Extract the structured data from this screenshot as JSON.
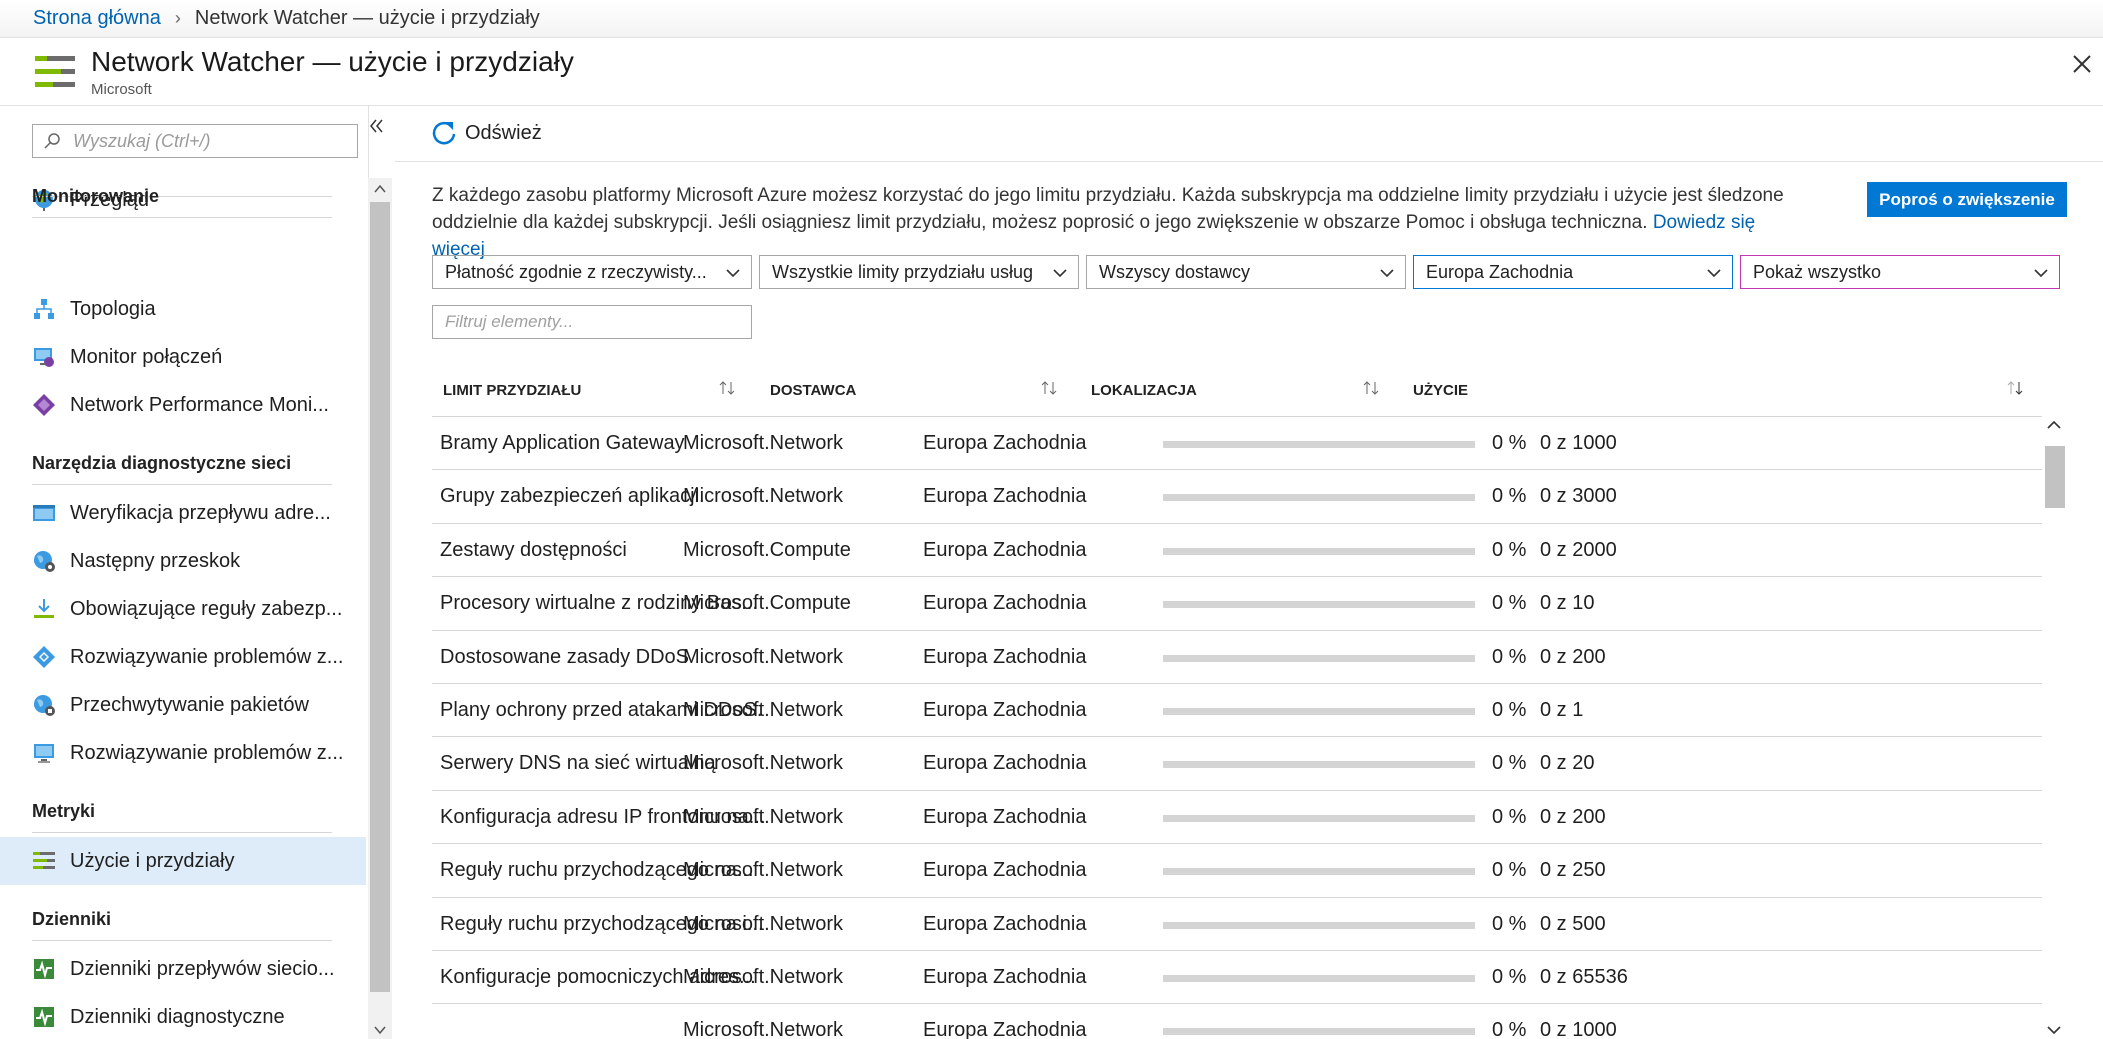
{
  "breadcrumb": {
    "home": "Strona główna",
    "current": "Network Watcher — użycie i przydziały"
  },
  "header": {
    "title": "Network Watcher — użycie i przydziały",
    "subtitle": "Microsoft"
  },
  "sidebar": {
    "search_placeholder": "Wyszukaj (Ctrl+/)",
    "overview": "Przegląd",
    "sections": {
      "monitoring": "Monitorowanie",
      "diagnostics": "Narzędzia diagnostyczne sieci",
      "metrics": "Metryki",
      "logs": "Dzienniki"
    },
    "items": {
      "topology": "Topologia",
      "connection_monitor": "Monitor połączeń",
      "npm": "Network Performance Moni...",
      "ip_flow": "Weryfikacja przepływu adre...",
      "next_hop": "Następny przeskok",
      "security_rules": "Obowiązujące reguły zabezp...",
      "vpn_troubleshoot": "Rozwiązywanie problemów z...",
      "packet_capture": "Przechwytywanie pakietów",
      "connection_troubleshoot": "Rozwiązywanie problemów z...",
      "usage_quotas": "Użycie i przydziały",
      "nsg_flow_logs": "Dzienniki przepływów siecio...",
      "diagnostic_logs": "Dzienniki diagnostyczne"
    }
  },
  "toolbar": {
    "refresh": "Odśwież"
  },
  "description": {
    "text": "Z każdego zasobu platformy Microsoft Azure możesz korzystać do jego limitu przydziału. Każda subskrypcja ma oddzielne limity przydziału i użycie jest śledzone oddzielnie dla każdej subskrypcji. Jeśli osiągniesz limit przydziału, możesz poprosić o jego zwiększenie w obszarze Pomoc i obsługa techniczna.",
    "learn_more": "Dowiedz się więcej"
  },
  "request_increase": "Poproś o zwiększenie",
  "filters": {
    "billing": "Płatność zgodnie z rzeczywisty...",
    "quota_limits": "Wszystkie limity przydziału usług",
    "providers": "Wszyscy dostawcy",
    "region": "Europa Zachodnia",
    "show": "Pokaż wszystko",
    "filter_placeholder": "Filtruj elementy..."
  },
  "table": {
    "headers": {
      "limit": "LIMIT PRZYDZIAŁU",
      "provider": "DOSTAWCA",
      "location": "LOKALIZACJA",
      "usage": "UŻYCIE"
    },
    "rows": [
      {
        "limit": "Bramy Application Gateway",
        "provider": "Microsoft.Network",
        "location": "Europa Zachodnia",
        "percent": "0 %",
        "usage": "0 z 1000",
        "fraction": 0
      },
      {
        "limit": "Grupy zabezpieczeń aplikacji.",
        "provider": "Microsoft.Network",
        "location": "Europa Zachodnia",
        "percent": "0 %",
        "usage": "0 z 3000",
        "fraction": 0
      },
      {
        "limit": "Zestawy dostępności",
        "provider": "Microsoft.Compute",
        "location": "Europa Zachodnia",
        "percent": "0 %",
        "usage": "0 z 2000",
        "fraction": 0
      },
      {
        "limit": "Procesory wirtualne z rodziny Bas...",
        "provider": "Microsoft.Compute",
        "location": "Europa Zachodnia",
        "percent": "0 %",
        "usage": "0 z 10",
        "fraction": 0
      },
      {
        "limit": "Dostosowane zasady DDoS",
        "provider": "Microsoft.Network",
        "location": "Europa Zachodnia",
        "percent": "0 %",
        "usage": "0 z 200",
        "fraction": 0
      },
      {
        "limit": "Plany ochrony przed atakami DDoS.",
        "provider": "Microsoft.Network",
        "location": "Europa Zachodnia",
        "percent": "0 %",
        "usage": "0 z 1",
        "fraction": 0
      },
      {
        "limit": "Serwery DNS na sieć wirtualną",
        "provider": "Microsoft.Network",
        "location": "Europa Zachodnia",
        "percent": "0 %",
        "usage": "0 z 20",
        "fraction": 0
      },
      {
        "limit": "Konfiguracja adresu IP frontonu na...",
        "provider": "Microsoft.Network",
        "location": "Europa Zachodnia",
        "percent": "0 %",
        "usage": "0 z 200",
        "fraction": 0
      },
      {
        "limit": "Reguły ruchu przychodzącego na...",
        "provider": "Microsoft.Network",
        "location": "Europa Zachodnia",
        "percent": "0 %",
        "usage": "0 z 250",
        "fraction": 0
      },
      {
        "limit": "Reguły ruchu przychodzącego na i...",
        "provider": "Microsoft.Network",
        "location": "Europa Zachodnia",
        "percent": "0 %",
        "usage": "0 z 500",
        "fraction": 0
      },
      {
        "limit": "Konfiguracje pomocniczych adres...",
        "provider": "Microsoft.Network",
        "location": "Europa Zachodnia",
        "percent": "0 %",
        "usage": "0 z 65536",
        "fraction": 0
      },
      {
        "limit": "",
        "provider": "Microsoft.Network",
        "location": "Europa Zachodnia",
        "percent": "0 %",
        "usage": "0 z 1000",
        "fraction": 0
      }
    ]
  },
  "colors": {
    "accent": "#0078d4",
    "link": "#0063b1",
    "selected": "#deecf9",
    "track": "#d4d4d4"
  }
}
